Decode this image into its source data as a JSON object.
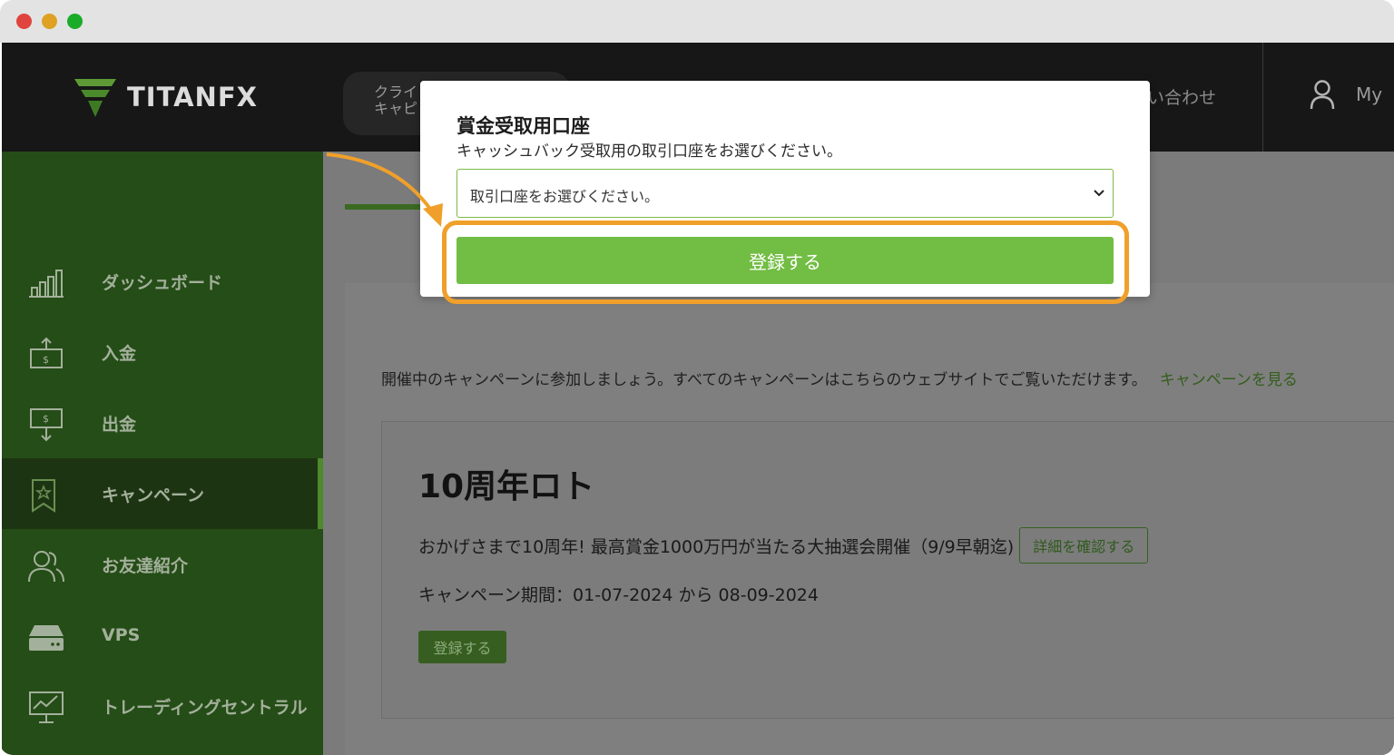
{
  "brand": {
    "logo_text": "TITANFX"
  },
  "header": {
    "client_line1": "クライ",
    "client_line2": "キャピ",
    "contact": "い合わせ",
    "user": "My"
  },
  "sidebar": {
    "items": [
      {
        "label": "ダッシュボード",
        "icon": "bar-chart-icon"
      },
      {
        "label": "入金",
        "icon": "deposit-icon"
      },
      {
        "label": "出金",
        "icon": "withdraw-icon"
      },
      {
        "label": "キャンペーン",
        "icon": "campaign-badge-icon",
        "active": true
      },
      {
        "label": "お友達紹介",
        "icon": "friends-icon"
      },
      {
        "label": "VPS",
        "icon": "server-icon"
      },
      {
        "label": "トレーディングセントラル",
        "icon": "monitor-chart-icon"
      }
    ]
  },
  "main": {
    "intro": "開催中のキャンペーンに参加しましょう。すべてのキャンペーンはこちらのウェブサイトでご覧いただけます。",
    "intro_link": "キャンペーンを見る",
    "campaign": {
      "title": "10周年ロト",
      "description": "おかげさまで10周年! 最高賞金1000万円が当たる大抽選会開催（9/9早朝迄)",
      "detail_button": "詳細を確認する",
      "period": "キャンペーン期間：01-07-2024 から 08-09-2024",
      "register_button": "登録する"
    }
  },
  "modal": {
    "title": "賞金受取用口座",
    "subtitle": "キャッシュバック受取用の取引口座をお選びください。",
    "select_placeholder": "取引口座をお選びください。",
    "submit_label": "登録する"
  },
  "colors": {
    "accent_green": "#72bd43",
    "highlight_orange": "#f0a02a",
    "sidebar_green": "#254d17"
  }
}
